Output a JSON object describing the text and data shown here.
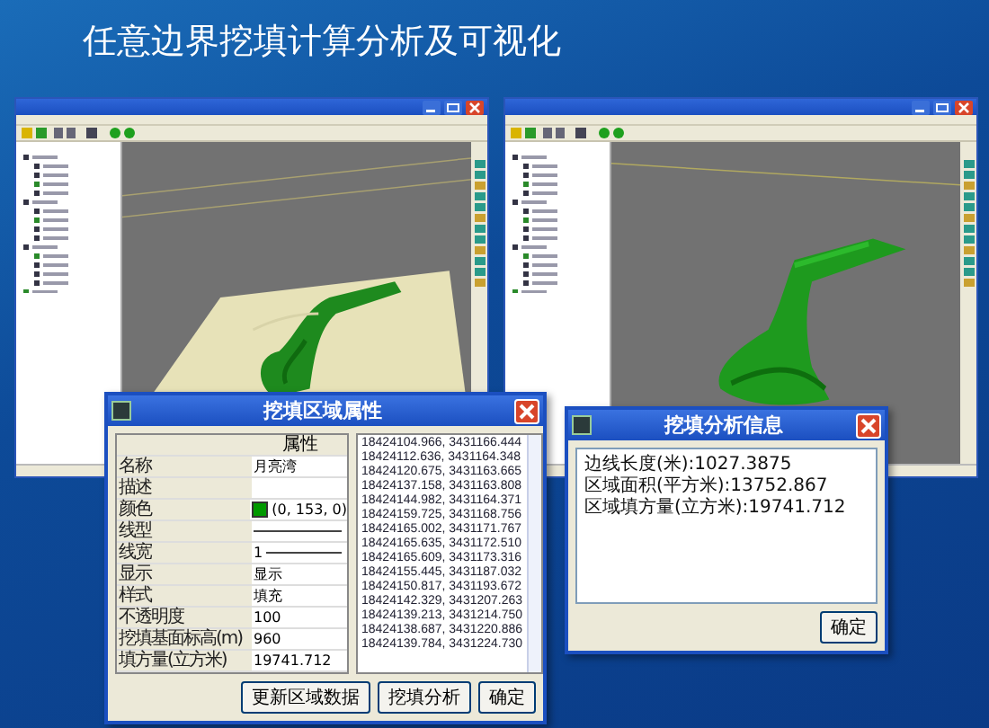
{
  "slide": {
    "title": "任意边界挖填计算分析及可视化"
  },
  "windows": [
    {
      "kind": "terrain"
    },
    {
      "kind": "model"
    }
  ],
  "properties_dialog": {
    "title": "挖填区域属性",
    "header": "属性",
    "rows": [
      {
        "kind": "text",
        "name": "名称",
        "value": "月亮湾"
      },
      {
        "kind": "text",
        "name": "描述"
      },
      {
        "kind": "color",
        "name": "颜色",
        "value": "(0, 153, 0)",
        "color": "#009900"
      },
      {
        "kind": "line",
        "name": "线型"
      },
      {
        "kind": "line",
        "name": "线宽",
        "value": "1"
      },
      {
        "kind": "text",
        "name": "显示",
        "value": "显示"
      },
      {
        "kind": "text",
        "name": "样式",
        "value": "填充"
      },
      {
        "kind": "text",
        "name": "不透明度",
        "value": "100"
      },
      {
        "kind": "text",
        "name": "挖填基面标高(m)",
        "value": "960"
      },
      {
        "kind": "text",
        "name": "填方量(立方米)",
        "value": "19741.712"
      }
    ],
    "coordinates": [
      "18424104.966, 3431166.444",
      "18424112.636, 3431164.348",
      "18424120.675, 3431163.665",
      "18424137.158, 3431163.808",
      "18424144.982, 3431164.371",
      "18424159.725, 3431168.756",
      "18424165.002, 3431171.767",
      "18424165.635, 3431172.510",
      "18424165.609, 3431173.316",
      "18424155.445, 3431187.032",
      "18424150.817, 3431193.672",
      "18424142.329, 3431207.263",
      "18424139.213, 3431214.750",
      "18424138.687, 3431220.886",
      "18424139.784, 3431224.730"
    ],
    "buttons": [
      "更新区域数据",
      "挖填分析",
      "确定"
    ]
  },
  "info_dialog": {
    "title": "挖填分析信息",
    "lines": [
      "边线长度(米):1027.3875",
      "区域面积(平方米):13752.867",
      "区域填方量(立方米):19741.712"
    ],
    "buttons": [
      "确定"
    ]
  }
}
